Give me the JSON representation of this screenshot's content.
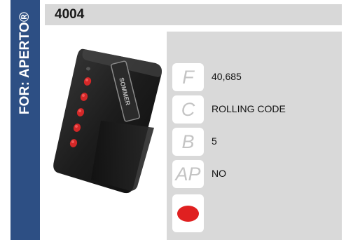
{
  "brand": {
    "label": "FOR: APERTO®"
  },
  "product": {
    "code": "4004"
  },
  "specs": [
    {
      "letter": "F",
      "value": "40,685"
    },
    {
      "letter": "C",
      "value": "ROLLING CODE"
    },
    {
      "letter": "B",
      "value": "5"
    },
    {
      "letter": "AP",
      "value": "NO"
    }
  ],
  "button_color": "#e02020",
  "remote_label": "SOMMER"
}
